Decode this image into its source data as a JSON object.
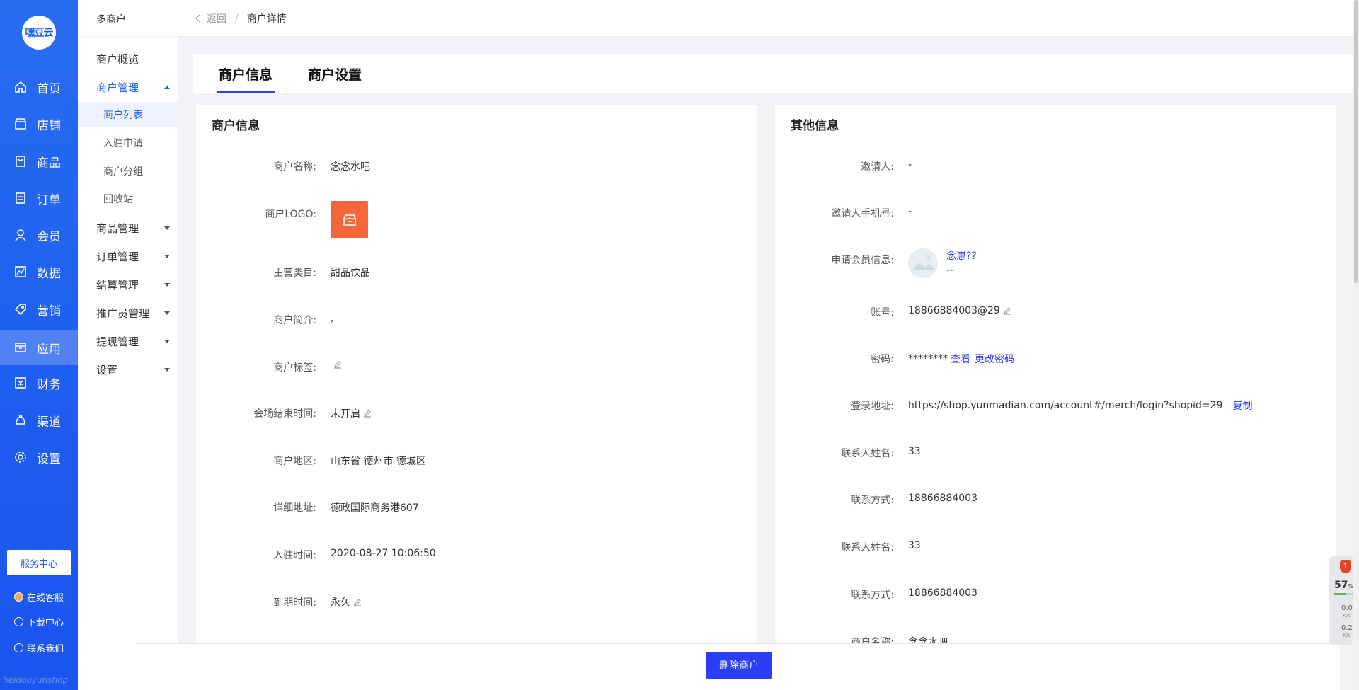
{
  "sidebar": {
    "logo": "嘿豆云",
    "items": [
      {
        "label": "首页",
        "icon": "home-icon"
      },
      {
        "label": "店铺",
        "icon": "store-icon"
      },
      {
        "label": "商品",
        "icon": "goods-icon"
      },
      {
        "label": "订单",
        "icon": "order-icon"
      },
      {
        "label": "会员",
        "icon": "user-icon"
      },
      {
        "label": "数据",
        "icon": "chart-icon"
      },
      {
        "label": "营销",
        "icon": "tag-icon"
      },
      {
        "label": "应用",
        "icon": "app-icon"
      },
      {
        "label": "财务",
        "icon": "finance-icon"
      },
      {
        "label": "渠道",
        "icon": "channel-icon"
      },
      {
        "label": "设置",
        "icon": "gear-icon"
      }
    ],
    "active_index": 7,
    "service_center": "服务中心",
    "online_service": "在线客服",
    "download_center": "下载中心",
    "contact_us": "联系我们",
    "watermark": "heidouyunshop"
  },
  "subnav": {
    "title": "多商户",
    "overview": "商户概览",
    "merchant_manage": "商户管理",
    "children": [
      "商户列表",
      "入驻申请",
      "商户分组",
      "回收站"
    ],
    "groups": [
      "商品管理",
      "订单管理",
      "结算管理",
      "推广员管理",
      "提现管理",
      "设置"
    ]
  },
  "breadcrumb": {
    "back": "返回",
    "separator": "/",
    "current": "商户详情"
  },
  "tabs": {
    "info": "商户信息",
    "settings": "商户设置"
  },
  "merchant_info": {
    "title": "商户信息",
    "name_label": "商户名称:",
    "name": "念念水吧",
    "logo_label": "商户LOGO:",
    "category_label": "主营类目:",
    "category": "甜品饮品",
    "intro_label": "商户简介:",
    "intro": ",",
    "tags_label": "商户标签:",
    "end_time_label": "会场结束时间:",
    "end_time": "未开启",
    "region_label": "商户地区:",
    "region": "山东省 德州市 德城区",
    "address_label": "详细地址:",
    "address": "德政国际商务港607",
    "join_time_label": "入驻时间:",
    "join_time": "2020-08-27 10:06:50",
    "expire_label": "到期时间:",
    "expire": "永久"
  },
  "other_info": {
    "title": "其他信息",
    "inviter_label": "邀请人:",
    "inviter": "-",
    "inviter_phone_label": "邀请人手机号:",
    "inviter_phone": "-",
    "member_label": "申请会员信息:",
    "member_name": "念崽??",
    "member_sub": "--",
    "account_label": "账号:",
    "account": "18866884003@29",
    "password_label": "密码:",
    "password": "********",
    "view": "查看",
    "change_password": "更改密码",
    "login_url_label": "登录地址:",
    "login_url": "https://shop.yunmadian.com/account#/merch/login?shopid=29",
    "copy": "复制",
    "contact_name_label": "联系人姓名:",
    "contact_name": "33",
    "contact_method_label": "联系方式:",
    "contact_method": "18866884003",
    "contact_name_label_2": "联系人姓名:",
    "contact_name_2": "33",
    "contact_method_label_2": "联系方式:",
    "contact_method_2": "18866884003",
    "merchant_name_label": "商户名称:",
    "merchant_name": "念念水吧"
  },
  "actions": {
    "delete": "删除商户"
  },
  "monitor": {
    "badge": "1",
    "cpu_percent": "57",
    "up": "0.0",
    "down": "0.2",
    "unit": "K/s"
  }
}
